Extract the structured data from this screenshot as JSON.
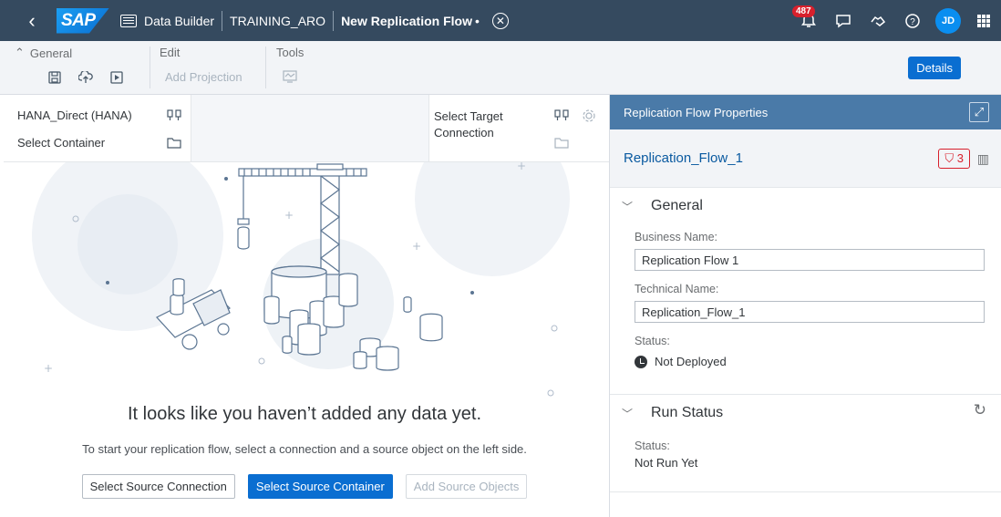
{
  "shell": {
    "logo": "SAP",
    "app": "Data Builder",
    "space": "TRAINING_ARO",
    "title": "New Replication Flow",
    "unsaved_mark": "•",
    "notifications_count": "487",
    "user_initials": "JD"
  },
  "toolbar": {
    "general": "General",
    "edit": "Edit",
    "add_projection": "Add Projection",
    "tools": "Tools",
    "details": "Details"
  },
  "source": {
    "connection": "HANA_Direct (HANA)",
    "container": "Select Container"
  },
  "target": {
    "connection": "Select Target Connection"
  },
  "empty_state": {
    "title": "It looks like you haven’t added any data yet.",
    "subtitle": "To start your replication flow, select a connection and a source object on the left side.",
    "btn_source_connection": "Select Source Connection",
    "btn_source_container": "Select Source Container",
    "btn_add_objects": "Add Source Objects"
  },
  "panel": {
    "header": "Replication Flow Properties",
    "object_name": "Replication_Flow_1",
    "validation_count": "3",
    "general": {
      "title": "General",
      "business_name_label": "Business Name:",
      "business_name": "Replication Flow 1",
      "technical_name_label": "Technical Name:",
      "technical_name": "Replication_Flow_1",
      "status_label": "Status:",
      "status": "Not Deployed"
    },
    "run_status": {
      "title": "Run Status",
      "status_label": "Status:",
      "status": "Not Run Yet"
    }
  },
  "colors": {
    "shell": "#354a5f",
    "accent": "#0a6ed1",
    "panel_header": "#4a7aa8",
    "error": "#d8202c"
  }
}
